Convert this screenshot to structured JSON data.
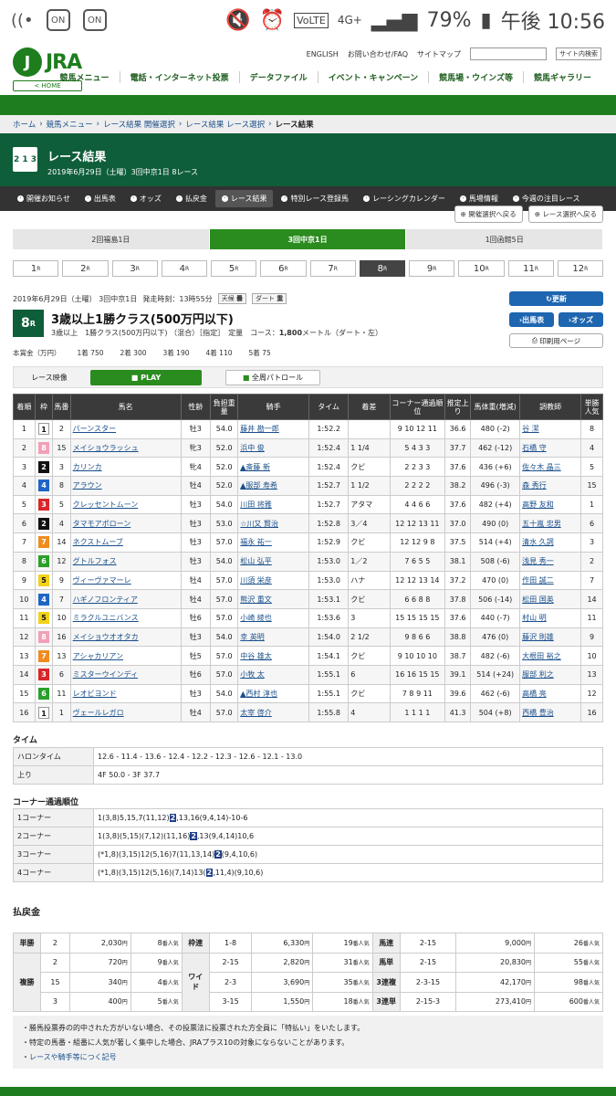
{
  "status": {
    "battery": "79%",
    "time": "午後 10:56",
    "net": "4G+",
    "volte": "VoLTE",
    "on1": "ON",
    "on2": "ON"
  },
  "header": {
    "logo": "JRA",
    "home": "< HOME",
    "links": [
      "ENGLISH",
      "お問い合わせ/FAQ",
      "サイトマップ"
    ],
    "search_btn": "サイト内検索",
    "nav": [
      "競馬メニュー",
      "電話・インターネット投票",
      "データファイル",
      "イベント・キャンペーン",
      "競馬場・ウインズ等",
      "競馬ギャラリー"
    ]
  },
  "breadcrumb": [
    "ホーム",
    "競馬メニュー",
    "レース結果 開催選択",
    "レース結果 レース選択",
    "レース結果"
  ],
  "title": {
    "main": "レース結果",
    "sub": "2019年6月29日（土曜）3回中京1日 8レース",
    "icon": "2 1 3"
  },
  "subnav": [
    "開催お知らせ",
    "出馬表",
    "オッズ",
    "払戻金",
    "レース結果",
    "特別レース登録馬",
    "レーシングカレンダー",
    "馬場情報",
    "今週の注目レース"
  ],
  "btns": {
    "back1": "開催選択へ戻る",
    "back2": "レース選択へ戻る"
  },
  "venues": [
    "2回福島1日",
    "3回中京1日",
    "1回函館5日"
  ],
  "races": [
    "1",
    "2",
    "3",
    "4",
    "5",
    "6",
    "7",
    "8",
    "9",
    "10",
    "11",
    "12"
  ],
  "race_suffix": "R",
  "race": {
    "date": "2019年6月29日（土曜） 3回中京1日",
    "start": "発走時刻：13時55分",
    "weather_label": "天候",
    "weather": "曇",
    "track_label": "ダート",
    "cond": "重",
    "num": "8",
    "num_suffix": "R",
    "name": "3歳以上1勝クラス(500万円以下)",
    "sub1": "3歳以上",
    "sub2": "1勝クラス(500万円以下)",
    "sub3": "（混合）［指定］",
    "sub4": "定量",
    "course_label": "コース：",
    "dist": "1,800",
    "dist_unit": "メートル",
    "surface": "（ダート・左）",
    "prize_label": "本賞金（万円）",
    "prizes": [
      [
        "1着",
        "750"
      ],
      [
        "2着",
        "300"
      ],
      [
        "3着",
        "190"
      ],
      [
        "4着",
        "110"
      ],
      [
        "5着",
        "75"
      ]
    ]
  },
  "side": {
    "refresh": "更新",
    "entries": "出馬表",
    "odds": "オッズ",
    "print": "印刷用ページ"
  },
  "video": {
    "label": "レース映像",
    "play": "PLAY",
    "patrol": "全周パトロール"
  },
  "cols": [
    "着順",
    "枠",
    "馬番",
    "馬名",
    "性齢",
    "負担重量",
    "騎手",
    "タイム",
    "着差",
    "コーナー通過順位",
    "推定上り",
    "馬体重(増減)",
    "調教師",
    "単勝人気"
  ],
  "rows": [
    [
      "1",
      "1",
      "2",
      "パーンスター",
      "牡3",
      "54.0",
      "藤井 勘一郎",
      "1:52.2",
      "",
      "9 10 12 11",
      "36.6",
      "480 (-2)",
      "谷 潔",
      "8"
    ],
    [
      "2",
      "8",
      "15",
      "メイショウラッシュ",
      "牝3",
      "52.0",
      "浜中 俊",
      "1:52.4",
      "1 1/4",
      "5 4 3 3",
      "37.7",
      "462 (-12)",
      "石橋 守",
      "4"
    ],
    [
      "3",
      "2",
      "3",
      "カリンカ",
      "牝4",
      "52.0",
      "▲斎藤 新",
      "1:52.4",
      "クビ",
      "2 2 3 3",
      "37.6",
      "436 (+6)",
      "佐々木 晶三",
      "5"
    ],
    [
      "4",
      "4",
      "8",
      "アラウン",
      "牡4",
      "52.0",
      "▲服部 寿希",
      "1:52.7",
      "1 1/2",
      "2 2 2 2",
      "38.2",
      "496 (-3)",
      "森 秀行",
      "15"
    ],
    [
      "5",
      "3",
      "5",
      "クレッセントムーン",
      "牡3",
      "54.0",
      "川田 将雅",
      "1:52.7",
      "アタマ",
      "4 4 6 6",
      "37.6",
      "482 (+4)",
      "高野 友和",
      "1"
    ],
    [
      "6",
      "2",
      "4",
      "タマモアポローン",
      "牡3",
      "53.0",
      "☆川又 賢治",
      "1:52.8",
      "3／4",
      "12 12 13 11",
      "37.0",
      "490 (0)",
      "五十嵐 忠男",
      "6"
    ],
    [
      "7",
      "7",
      "14",
      "ネクストムーブ",
      "牡3",
      "57.0",
      "福永 祐一",
      "1:52.9",
      "クビ",
      "12 12 9 8",
      "37.5",
      "514 (+4)",
      "清水 久詞",
      "3"
    ],
    [
      "8",
      "6",
      "12",
      "グトルフォス",
      "牡3",
      "54.0",
      "松山 弘平",
      "1:53.0",
      "1／2",
      "7 6 5 5",
      "38.1",
      "508 (-6)",
      "浅見 秀一",
      "2"
    ],
    [
      "9",
      "5",
      "9",
      "ヴィーヴァマーレ",
      "牡4",
      "57.0",
      "川須 栄彦",
      "1:53.0",
      "ハナ",
      "12 12 13 14",
      "37.2",
      "470 (0)",
      "作田 誠二",
      "7"
    ],
    [
      "10",
      "4",
      "7",
      "ハギノフロンティア",
      "牡4",
      "57.0",
      "熊沢 重文",
      "1:53.1",
      "クビ",
      "6 6 8 8",
      "37.8",
      "506 (-14)",
      "松田 国英",
      "14"
    ],
    [
      "11",
      "5",
      "10",
      "ミラクルユニバンス",
      "牡6",
      "57.0",
      "小崎 綾也",
      "1:53.6",
      "3",
      "15 15 15 15",
      "37.6",
      "440 (-7)",
      "村山 明",
      "11"
    ],
    [
      "12",
      "8",
      "16",
      "メイショウオオタカ",
      "牡3",
      "54.0",
      "幸 英明",
      "1:54.0",
      "2 1/2",
      "9 8 6 6",
      "38.8",
      "476 (0)",
      "藤沢 則雄",
      "9"
    ],
    [
      "13",
      "7",
      "13",
      "アシャカリアン",
      "牡5",
      "57.0",
      "中谷 雄太",
      "1:54.1",
      "クビ",
      "9 10 10 10",
      "38.7",
      "482 (-6)",
      "大根田 裕之",
      "10"
    ],
    [
      "14",
      "3",
      "6",
      "ミスターウインディ",
      "牡6",
      "57.0",
      "小牧 太",
      "1:55.1",
      "6",
      "16 16 15 15",
      "39.1",
      "514 (+24)",
      "服部 利之",
      "13"
    ],
    [
      "15",
      "6",
      "11",
      "レオビヨンド",
      "牡3",
      "54.0",
      "▲西村 淳也",
      "1:55.1",
      "クビ",
      "7 8 9 11",
      "39.6",
      "462 (-6)",
      "高橋 亮",
      "12"
    ],
    [
      "16",
      "1",
      "1",
      "ヴェールレガロ",
      "牡4",
      "57.0",
      "太宰 啓介",
      "1:55.8",
      "4",
      "1 1 1 1",
      "41.3",
      "504 (+8)",
      "西橋 豊治",
      "16"
    ]
  ],
  "time_sec": {
    "title": "タイム",
    "rows": [
      [
        "ハロンタイム",
        "12.6 - 11.4 - 13.6 - 12.4 - 12.2 - 12.3 - 12.6 - 12.1 - 13.0"
      ],
      [
        "上り",
        "4F 50.0 - 3F 37.7"
      ]
    ]
  },
  "corner_sec": {
    "title": "コーナー通過順位",
    "rows": [
      [
        "1コーナー",
        "1(3,8)5,15,7(11,12)",
        "2",
        ",13,16(9,4,14)-10-6"
      ],
      [
        "2コーナー",
        "1(3,8)(5,15)(7,12)(11,16)",
        "2",
        ",13(9,4,14)10,6"
      ],
      [
        "3コーナー",
        "(*1,8)(3,15)12(5,16)7(11,13,14)",
        "2",
        "(9,4,10,6)"
      ],
      [
        "4コーナー",
        "(*1,8)(3,15)12(5,16)(7,14)13(",
        "2",
        ",11,4)(9,10,6)"
      ]
    ]
  },
  "pay": {
    "title": "払戻金",
    "unit": "円",
    "pop_unit": "番人気",
    "tansho": {
      "label": "単勝",
      "rows": [
        [
          "2",
          "2,030",
          "8"
        ]
      ]
    },
    "fukusho": {
      "label": "複勝",
      "rows": [
        [
          "2",
          "720",
          "9"
        ],
        [
          "15",
          "340",
          "4"
        ],
        [
          "3",
          "400",
          "5"
        ]
      ]
    },
    "wakuren": {
      "label": "枠連",
      "rows": [
        [
          "1-8",
          "6,330",
          "19"
        ]
      ]
    },
    "wide": {
      "label": "ワイド",
      "rows": [
        [
          "2-15",
          "2,820",
          "31"
        ],
        [
          "2-3",
          "3,690",
          "35"
        ],
        [
          "3-15",
          "1,550",
          "18"
        ]
      ]
    },
    "umaren": {
      "label": "馬連",
      "rows": [
        [
          "2-15",
          "9,000",
          "26"
        ]
      ]
    },
    "umatan": {
      "label": "馬単",
      "rows": [
        [
          "2-15",
          "20,830",
          "55"
        ]
      ]
    },
    "sanpuku": {
      "label": "3連複",
      "rows": [
        [
          "2-3-15",
          "42,170",
          "98"
        ]
      ]
    },
    "santan": {
      "label": "3連単",
      "rows": [
        [
          "2-15-3",
          "273,410",
          "600"
        ]
      ]
    }
  },
  "notes": [
    "勝馬投票券の的中された方がいない場合、その投票法に投票された方全員に「特払い」をいたします。",
    "特定の馬番・組番に人気が著しく集中した場合、JRAプラス10の対象にならないことがあります。",
    "レースや騎手等につく記号"
  ],
  "colors": {
    "waku": [
      "#ffffff",
      "#ffffff",
      "#111111",
      "#d9262a",
      "#1e66c6",
      "#f2d21a",
      "#2aa02a",
      "#f08c1e",
      "#f2a0b8"
    ]
  }
}
